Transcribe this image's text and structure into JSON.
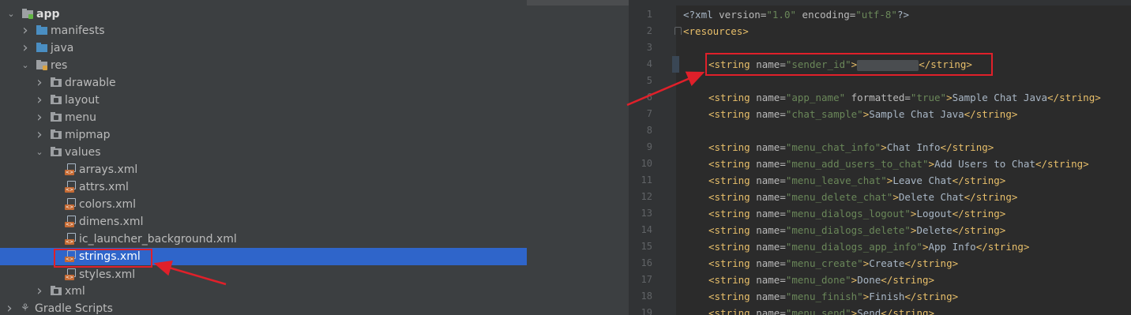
{
  "tree": {
    "items": [
      {
        "label": "app",
        "kind": "module",
        "chevron": "v",
        "bold": true
      },
      {
        "label": "manifests",
        "kind": "folder",
        "chevron": ">"
      },
      {
        "label": "java",
        "kind": "folder",
        "chevron": ">"
      },
      {
        "label": "res",
        "kind": "resfolder",
        "chevron": "v"
      },
      {
        "label": "drawable",
        "kind": "pkg",
        "chevron": ">"
      },
      {
        "label": "layout",
        "kind": "pkg",
        "chevron": ">"
      },
      {
        "label": "menu",
        "kind": "pkg",
        "chevron": ">"
      },
      {
        "label": "mipmap",
        "kind": "pkg",
        "chevron": ">"
      },
      {
        "label": "values",
        "kind": "pkg",
        "chevron": "v"
      },
      {
        "label": "arrays.xml",
        "kind": "xml",
        "chevron": ""
      },
      {
        "label": "attrs.xml",
        "kind": "xml",
        "chevron": ""
      },
      {
        "label": "colors.xml",
        "kind": "xml",
        "chevron": ""
      },
      {
        "label": "dimens.xml",
        "kind": "xml",
        "chevron": ""
      },
      {
        "label": "ic_launcher_background.xml",
        "kind": "xml",
        "chevron": ""
      },
      {
        "label": "strings.xml",
        "kind": "xml",
        "chevron": "",
        "selected": true
      },
      {
        "label": "styles.xml",
        "kind": "xml",
        "chevron": ""
      },
      {
        "label": "xml",
        "kind": "pkg",
        "chevron": ">"
      },
      {
        "label": "Gradle Scripts",
        "kind": "gradle",
        "chevron": ">"
      }
    ]
  },
  "editor": {
    "line_numbers": [
      "1",
      "2",
      "3",
      "4",
      "5",
      "6",
      "7",
      "8",
      "9",
      "10",
      "11",
      "12",
      "13",
      "14",
      "15",
      "16",
      "17",
      "18",
      "19"
    ],
    "prolog": "<?xml version=\"1.0\" encoding=\"utf-8\"?>",
    "root_open": "<resources>",
    "strings": [
      {
        "line": 4,
        "name": "sender_id",
        "value": "",
        "redacted": true
      },
      {
        "line": 6,
        "name": "app_name",
        "extra_attr": "formatted",
        "extra_val": "true",
        "value": "Sample Chat Java"
      },
      {
        "line": 7,
        "name": "chat_sample",
        "value": "Sample Chat Java"
      },
      {
        "line": 9,
        "name": "menu_chat_info",
        "value": "Chat Info"
      },
      {
        "line": 10,
        "name": "menu_add_users_to_chat",
        "value": "Add Users to Chat"
      },
      {
        "line": 11,
        "name": "menu_leave_chat",
        "value": "Leave Chat"
      },
      {
        "line": 12,
        "name": "menu_delete_chat",
        "value": "Delete Chat"
      },
      {
        "line": 13,
        "name": "menu_dialogs_logout",
        "value": "Logout"
      },
      {
        "line": 14,
        "name": "menu_dialogs_delete",
        "value": "Delete"
      },
      {
        "line": 15,
        "name": "menu_dialogs_app_info",
        "value": "App Info"
      },
      {
        "line": 16,
        "name": "menu_create",
        "value": "Create"
      },
      {
        "line": 17,
        "name": "menu_done",
        "value": "Done"
      },
      {
        "line": 18,
        "name": "menu_finish",
        "value": "Finish"
      },
      {
        "line": 19,
        "name": "menu_send",
        "value": "Send"
      }
    ]
  },
  "colors": {
    "selection": "#2f65ca",
    "annotation_red": "#e0202a",
    "xml_tag": "#e8bf6a",
    "xml_value": "#6a8759",
    "folder_blue": "#4a8ec2",
    "folder_gray": "#9da0a3"
  }
}
